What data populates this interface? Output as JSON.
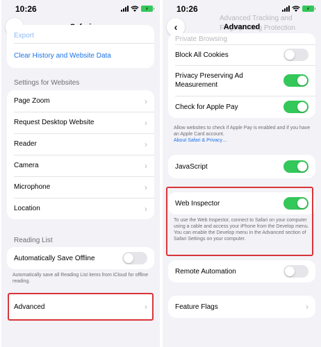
{
  "status": {
    "time": "10:26",
    "battery": "⚡"
  },
  "left": {
    "back_icon": "chevron-left-icon",
    "title": "Safari",
    "top_partial": "Export",
    "clear_history": "Clear History and Website Data",
    "settings_header": "Settings for Websites",
    "website_items": [
      "Page Zoom",
      "Request Desktop Website",
      "Reader",
      "Camera",
      "Microphone",
      "Location"
    ],
    "reading_header": "Reading List",
    "save_offline": "Automatically Save Offline",
    "save_offline_on": false,
    "reading_footer": "Automatically save all Reading List items from iCloud for offline reading.",
    "advanced": "Advanced"
  },
  "right": {
    "back_icon": "chevron-left-icon",
    "title": "Advanced",
    "behind_lines": [
      "Advanced Tracking and",
      "Fingerprinting Protection"
    ],
    "top_partial": "Private Browsing",
    "block_cookies": "Block All Cookies",
    "block_cookies_on": false,
    "privacy_ad": "Privacy Preserving Ad Measurement",
    "privacy_ad_on": true,
    "apple_pay": "Check for Apple Pay",
    "apple_pay_on": true,
    "pay_footer": "Allow websites to check if Apple Pay is enabled and if you have an Apple Card account.",
    "pay_footer_link": "About Safari & Privacy…",
    "javascript": "JavaScript",
    "javascript_on": true,
    "web_inspector": "Web Inspector",
    "web_inspector_on": true,
    "inspector_footer": "To use the Web Inspector, connect to Safari on your computer using a cable and access your iPhone from the Develop menu. You can enable the Develop menu in the Advanced section of Safari Settings on your computer.",
    "remote_automation": "Remote Automation",
    "remote_automation_on": false,
    "feature_flags": "Feature Flags"
  },
  "colors": {
    "accent": "#1a73e8",
    "toggle_on": "#34c759",
    "highlight": "#d93438"
  }
}
